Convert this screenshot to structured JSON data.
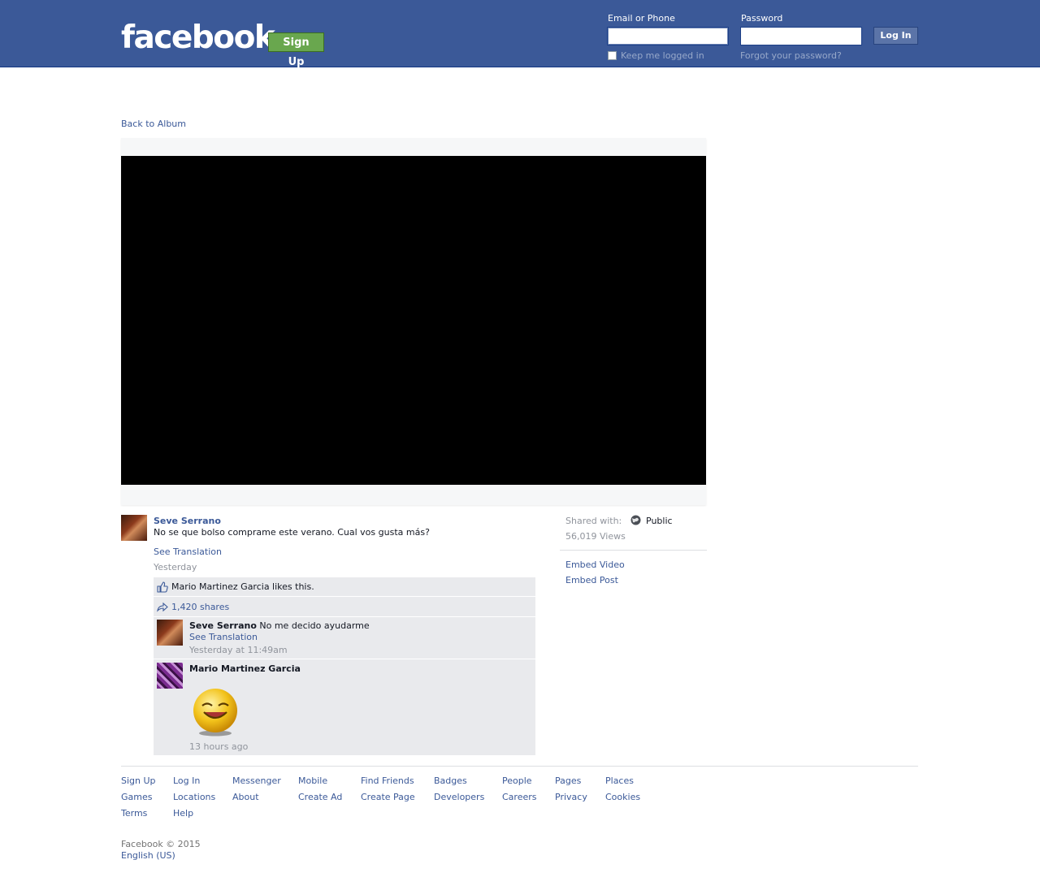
{
  "header": {
    "logo": "facebook",
    "signup_label": "Sign Up",
    "email_label": "Email or Phone",
    "password_label": "Password",
    "login_label": "Log In",
    "keep_logged_label": "Keep me logged in",
    "forgot_label": "Forgot your password?",
    "brand_color": "#3b5998"
  },
  "nav": {
    "back_label": "Back to Album"
  },
  "post": {
    "author": "Seve Serrano",
    "caption": "No se que bolso comprame este verano. Cual vos gusta más?",
    "see_translation": "See Translation",
    "timestamp": "Yesterday",
    "likes_text": "Mario Martinez Garcia likes this.",
    "shares_text": "1,420 shares"
  },
  "comments": [
    {
      "name": "Seve Serrano",
      "text": "No me decido ayudarme",
      "see_translation": "See Translation",
      "time": "Yesterday at 11:49am"
    },
    {
      "name": "Mario Martinez Garcia",
      "sticker": "laughing-emoji-sticker",
      "time": "13 hours ago"
    }
  ],
  "sidebar": {
    "shared_with_label": "Shared with:",
    "audience": "Public",
    "views": "56,019 Views",
    "embed_video": "Embed Video",
    "embed_post": "Embed Post"
  },
  "footer": {
    "columns": [
      [
        "Sign Up",
        "Games",
        "Terms"
      ],
      [
        "Log In",
        "Locations",
        "Help"
      ],
      [
        "Messenger",
        "About"
      ],
      [
        "Mobile",
        "Create Ad"
      ],
      [
        "Find Friends",
        "Create Page"
      ],
      [
        "Badges",
        "Developers"
      ],
      [
        "People",
        "Careers"
      ],
      [
        "Pages",
        "Privacy"
      ],
      [
        "Places",
        "Cookies"
      ]
    ],
    "copyright": "Facebook © 2015",
    "language": "English (US)"
  }
}
